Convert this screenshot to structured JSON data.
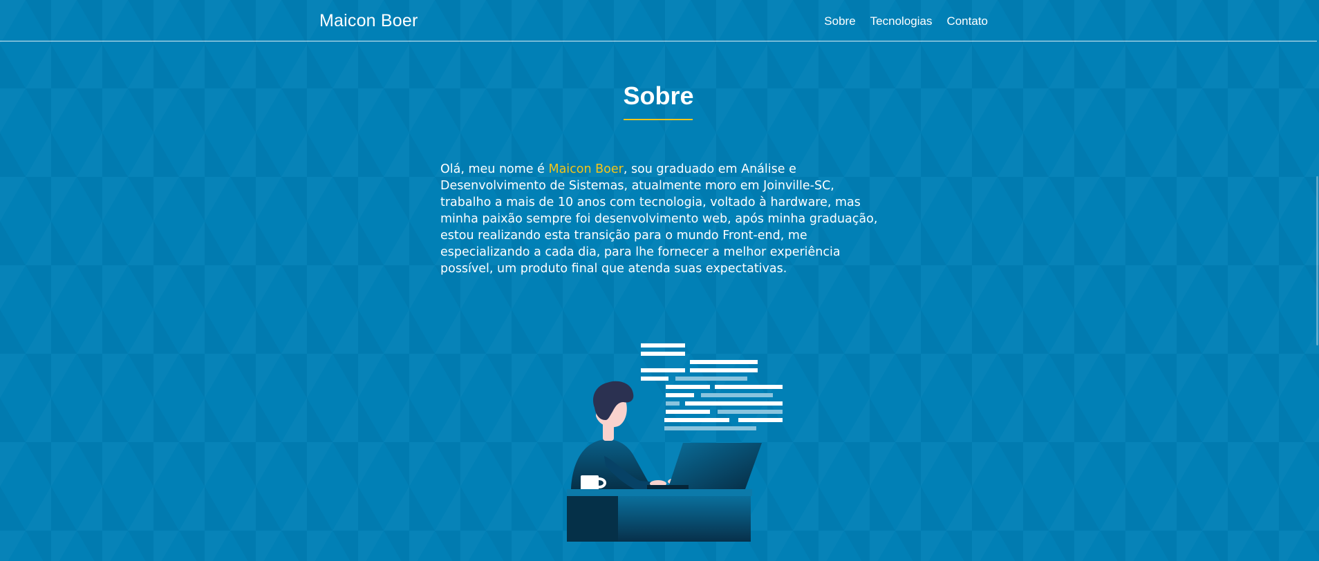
{
  "header": {
    "brand": "Maicon Boer",
    "nav": [
      {
        "label": "Sobre"
      },
      {
        "label": "Tecnologias"
      },
      {
        "label": "Contato"
      }
    ]
  },
  "about": {
    "title": "Sobre",
    "text_before": "Olá, meu nome é ",
    "name_highlight": "Maicon Boer",
    "text_after": ", sou graduado em Análise e Desenvolvimento de Sistemas, atualmente moro em Joinville-SC, trabalho a mais de 10 anos com tecnologia, voltado à hardware, mas minha paixão sempre foi desenvolvimento web, após minha graduação, estou realizando esta transição para o mundo Front-end, me especializando a cada dia, para lhe fornecer a melhor experiência possível, um produto final que atenda suas expectativas."
  },
  "illustration": {
    "icon": "developer-at-laptop-illustration"
  },
  "colors": {
    "background": "#0180b6",
    "accent": "#f5c518",
    "text": "#ffffff"
  }
}
